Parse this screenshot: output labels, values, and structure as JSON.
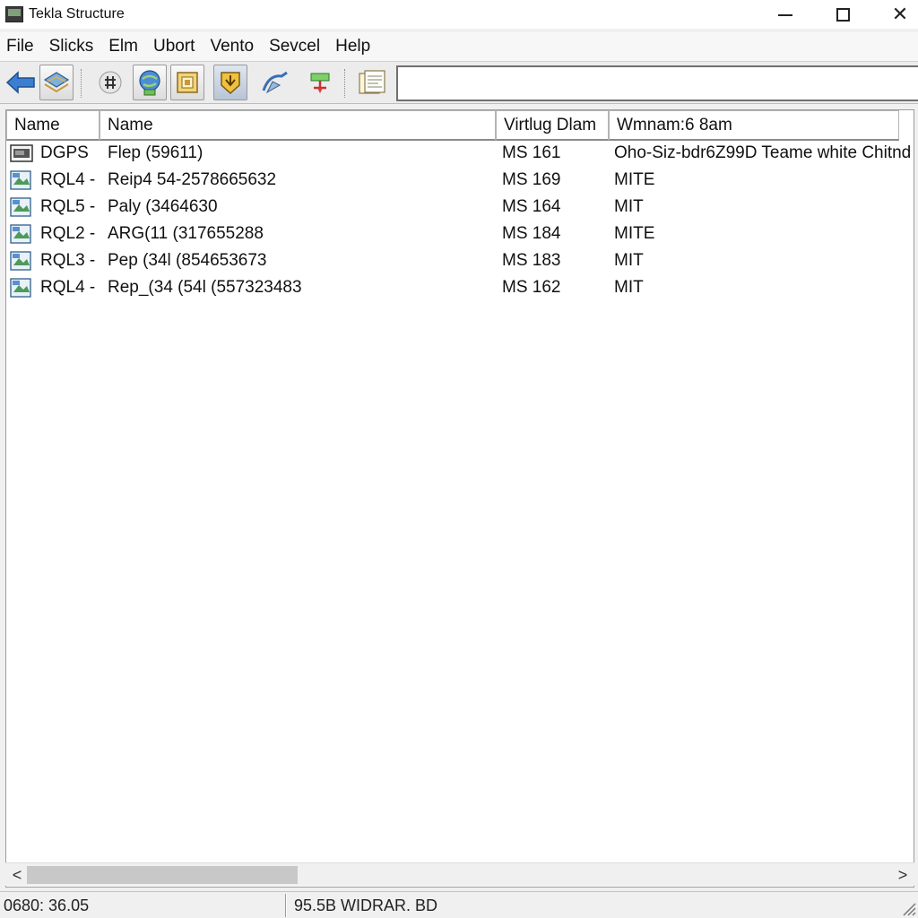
{
  "window": {
    "title": "Tekla Structure",
    "close_glyph": "✕"
  },
  "menu": [
    "File",
    "Slicks",
    "Elm",
    "Ubort",
    "Vento",
    "Sevcel",
    "Help"
  ],
  "toolbar": {
    "icons": [
      "back-arrow-icon",
      "layers-icon",
      "grid-icon",
      "globe-icon",
      "frame-icon",
      "shield-arrow-icon",
      "fly-icon",
      "network-icon",
      "document-icon"
    ],
    "address_value": ""
  },
  "list": {
    "columns": [
      "Name",
      "Name",
      "Virtlug Dlam",
      "Wmnam:6 8am"
    ],
    "rows": [
      {
        "icon": "file-monitor-icon",
        "c1": "DGPS",
        "c2": "Flep (59611)",
        "c3": "MS 161",
        "c4": "Oho-Siz-bdr6Z99D Teame white Chitnd"
      },
      {
        "icon": "file-image-icon",
        "c1": "RQL4 -",
        "c2": "Reip4 54-2578665632",
        "c3": "MS 169",
        "c4": "MITE"
      },
      {
        "icon": "file-image-icon",
        "c1": "RQL5 -",
        "c2": "Paly (3464630",
        "c3": "MS 164",
        "c4": "MIT"
      },
      {
        "icon": "file-image-icon",
        "c1": "RQL2 -",
        "c2": "ARG(11 (317655288",
        "c3": "MS 184",
        "c4": "MITE"
      },
      {
        "icon": "file-image-icon",
        "c1": "RQL3 -",
        "c2": "Pep (34l (854653673",
        "c3": "MS 183",
        "c4": "MIT"
      },
      {
        "icon": "file-image-icon",
        "c1": "RQL4 -",
        "c2": "Rep_(34 (54l (557323483",
        "c3": "MS 162",
        "c4": "MIT"
      }
    ]
  },
  "scrollbar": {
    "left": "<",
    "right": ">"
  },
  "status": {
    "left": "0680: 36.05",
    "right": "95.5B  WIDRAR. BD"
  },
  "colors": {
    "accent_blue": "#2f6fb5",
    "toolbar_bg": "#ececec",
    "list_bg": "#ffffff"
  }
}
